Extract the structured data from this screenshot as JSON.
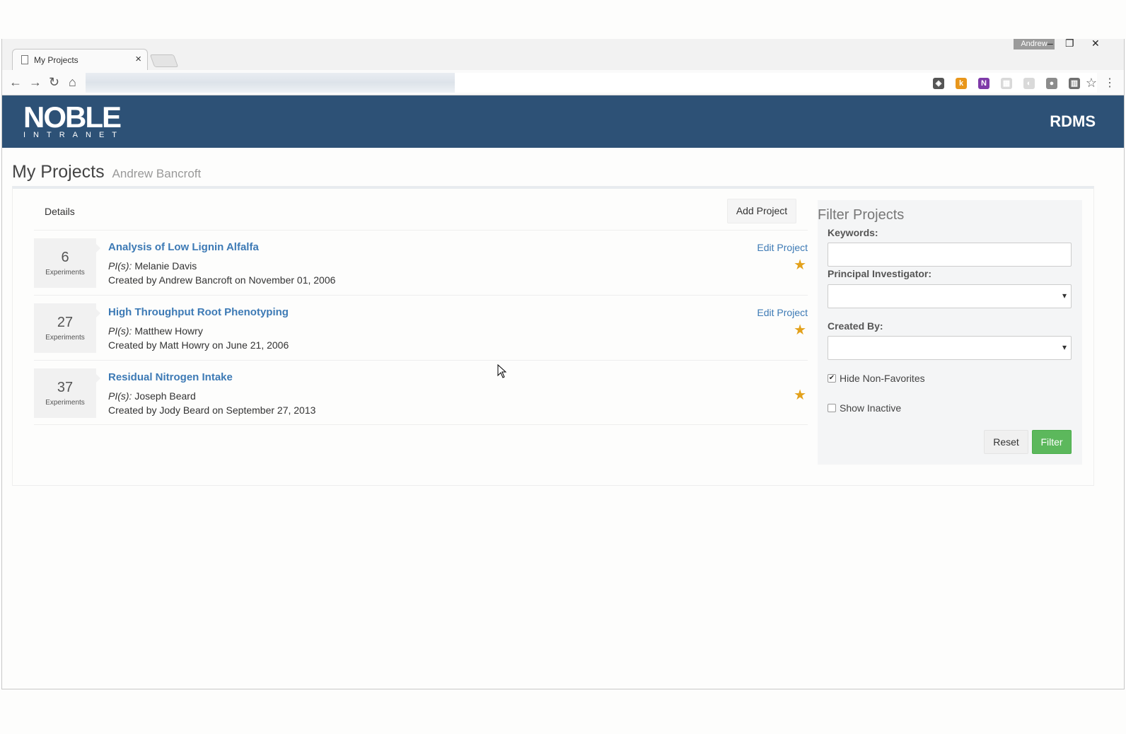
{
  "browser": {
    "tab_title": "My Projects",
    "tab_close": "×",
    "profile_name": "Andrew",
    "win_minimize": "–",
    "win_maximize": "❐",
    "win_close": "✕",
    "back": "←",
    "forward": "→",
    "reload": "↻",
    "home": "⌂",
    "bookmark_star": "☆",
    "menu": "⋮",
    "extensions": [
      {
        "icon": "shield-extension-icon",
        "glyph": "◈",
        "color": "#555555"
      },
      {
        "icon": "k-extension-icon",
        "glyph": "k",
        "color": "#e8961b"
      },
      {
        "icon": "onenote-extension-icon",
        "glyph": "N",
        "color": "#7e3aa8"
      },
      {
        "icon": "grid-extension-icon",
        "glyph": "▦",
        "color": "#d9d9d9"
      },
      {
        "icon": "leaf-extension-icon",
        "glyph": "◐",
        "color": "#d9d9d9"
      },
      {
        "icon": "circle-extension-icon",
        "glyph": "●",
        "color": "#8c8c8c"
      },
      {
        "icon": "trello-extension-icon",
        "glyph": "▥",
        "color": "#707070"
      }
    ]
  },
  "header": {
    "logo_main": "NOBLE",
    "logo_sub": "INTRANET",
    "app_name": "RDMS"
  },
  "page": {
    "title": "My Projects",
    "subtitle": "Andrew Bancroft"
  },
  "list": {
    "details_label": "Details",
    "add_project_label": "Add Project",
    "projects": [
      {
        "count": "6",
        "count_label": "Experiments",
        "title": "Analysis of Low Lignin Alfalfa",
        "pi_label": "PI(s):",
        "pi": "Melanie Davis",
        "created": "Created by Andrew Bancroft on November 01, 2006",
        "edit_label": "Edit Project",
        "star": "★"
      },
      {
        "count": "27",
        "count_label": "Experiments",
        "title": "High Throughput Root Phenotyping",
        "pi_label": "PI(s):",
        "pi": "Matthew Howry",
        "created": "Created by Matt Howry on June 21, 2006",
        "edit_label": "Edit Project",
        "star": "★"
      },
      {
        "count": "37",
        "count_label": "Experiments",
        "title": "Residual Nitrogen Intake",
        "pi_label": "PI(s):",
        "pi": "Joseph Beard",
        "created": "Created by Jody Beard on September 27, 2013",
        "edit_label": "",
        "star": "★"
      }
    ]
  },
  "filter": {
    "title": "Filter Projects",
    "keywords_label": "Keywords:",
    "keywords_value": "",
    "pi_label": "Principal Investigator:",
    "pi_value": "",
    "created_by_label": "Created By:",
    "created_by_value": "",
    "hide_non_favorites_label": "Hide Non-Favorites",
    "hide_non_favorites_checked": "✔",
    "show_inactive_label": "Show Inactive",
    "show_inactive_checked": "",
    "reset_label": "Reset",
    "filter_label": "Filter"
  },
  "colors": {
    "header_bg": "#2d5176",
    "link": "#3d7ab5",
    "star": "#e3a11b",
    "filter_button": "#5cb85c"
  }
}
